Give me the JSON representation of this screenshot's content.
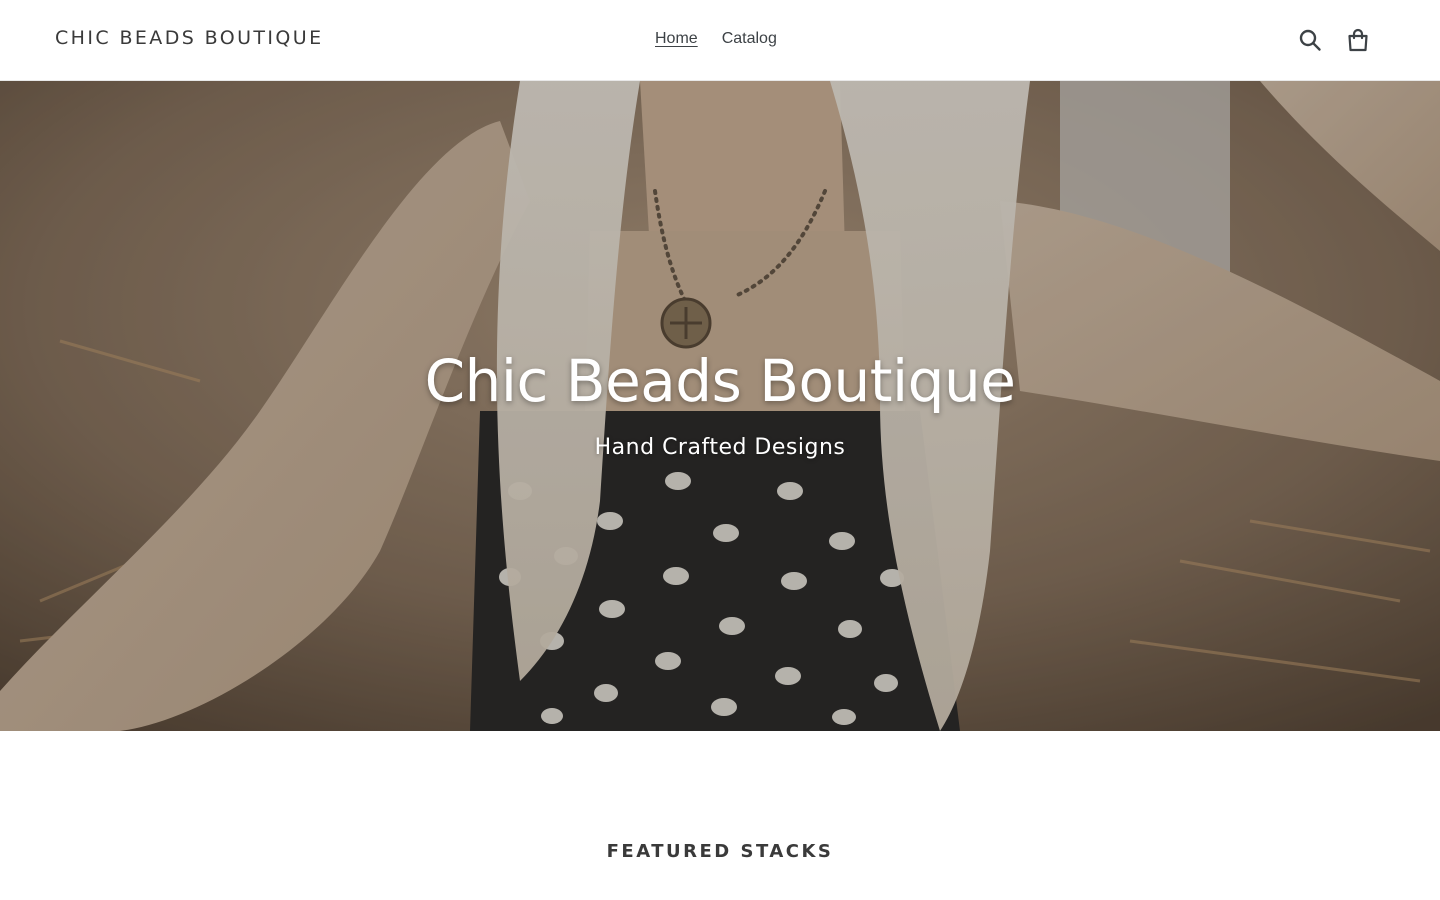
{
  "header": {
    "logo": "CHIC BEADS BOUTIQUE",
    "nav": [
      {
        "label": "Home",
        "active": true
      },
      {
        "label": "Catalog",
        "active": false
      }
    ],
    "icons": [
      "search-icon",
      "cart-icon"
    ]
  },
  "hero": {
    "title": "Chic Beads Boutique",
    "subtitle": "Hand Crafted Designs"
  },
  "featured": {
    "heading": "FEATURED STACKS"
  },
  "colors": {
    "text": "#3a3a3a",
    "nav_text": "#3d4246",
    "hero_text": "#ffffff",
    "background": "#ffffff"
  }
}
